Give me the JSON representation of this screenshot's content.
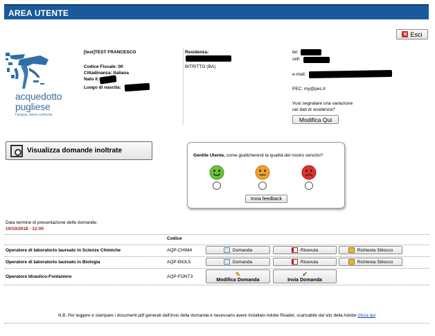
{
  "header": {
    "title": "AREA UTENTE"
  },
  "exit_button": {
    "label": "Esci",
    "icon": "close-icon"
  },
  "logo": {
    "line1": "acquedotto",
    "line2": "pugliese",
    "tagline": "l'acqua, bene comune"
  },
  "user": {
    "name": "[test]TEST FRANCESCO",
    "codice_fiscale": "Codice Fiscale: 00",
    "cittadinanza": "Cittadinanza: Italiana",
    "nato_il": "Nato il:",
    "luogo_nascita": "Luogo di nascita:"
  },
  "residence": {
    "label": "Residenza:",
    "city": "BITRITTO (BA)"
  },
  "contacts": {
    "tel": "tel:",
    "cell": "cell:",
    "email": "e-mail:",
    "pec": "PEC: my@pec.it"
  },
  "variation": {
    "line1": "Vuoi segnalare una variazione",
    "line2": "nei dati di residenza?",
    "button": "Modifica Qui"
  },
  "view_applications": {
    "label": "Visualizza domande inoltrate"
  },
  "feedback": {
    "question_bold": "Gentile Utente,",
    "question_rest": " come giudicheresti la qualità del nostro servizio?",
    "options": [
      {
        "icon": "happy-smiley-icon",
        "color": "#6cc23a"
      },
      {
        "icon": "neutral-smiley-icon",
        "color": "#f0a030"
      },
      {
        "icon": "sad-smiley-icon",
        "color": "#e03030"
      }
    ],
    "submit": "Invia feedback"
  },
  "deadline": {
    "label": "Data termine di presentazione delle domande:",
    "value": "10/10/2018 - 12:00"
  },
  "table": {
    "code_header": "Codice",
    "rows": [
      {
        "name": "Operatore di laboratorio laureato in Scienze Chimiche",
        "code": "AQP-CHIM4",
        "btn1": "Domanda",
        "btn2": "Ricevuta",
        "btn3": "Richiesta Sblocco"
      },
      {
        "name": "Operatore di laboratorio laureato in Biologia",
        "code": "AQP-BIOL5",
        "btn1": "Domanda",
        "btn2": "Ricevuta",
        "btn3": "Richiesta Sblocco"
      },
      {
        "name": "Operatore Idraulico-Fontaniere",
        "code": "AQP-FONT3",
        "btn1": "Modifica Domanda",
        "btn2": "Invia Domanda"
      }
    ]
  },
  "footer": {
    "note": "N.B. Per leggere e stampare i documenti pdf generati dall'invio della domanda è necessario avere installato Adobe Reader, scaricabile dal sito della Adobe",
    "link": "clicca qui"
  }
}
